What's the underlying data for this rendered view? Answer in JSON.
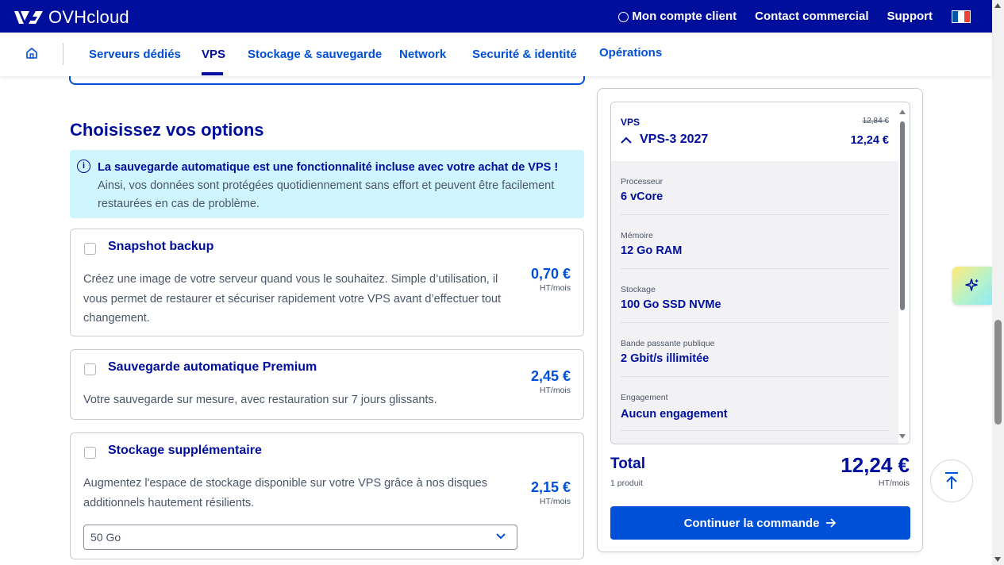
{
  "topbar": {
    "logo_text": "OVHcloud",
    "account_label": "Mon compte client",
    "contact_label": "Contact commercial",
    "support_label": "Support",
    "flag_colors": [
      "#0055a4",
      "#ffffff",
      "#ef4135"
    ]
  },
  "nav": {
    "items": [
      {
        "label": "Serveurs dédiés"
      },
      {
        "label": "VPS"
      },
      {
        "label": "Stockage & sauvegarde"
      },
      {
        "label": "Network"
      },
      {
        "label": "Securité & identité"
      },
      {
        "label": "Opérations"
      }
    ],
    "active": "VPS"
  },
  "main": {
    "section_title": "Choisissez vos options",
    "info": {
      "title": "La sauvegarde automatique est une fonctionnalité incluse avec votre achat de VPS !",
      "body": "Ainsi, vos données sont protégées quotidiennement sans effort et peuvent être facilement restaurées en cas de problème."
    },
    "options": [
      {
        "title": "Snapshot backup",
        "description": "Créez une image de votre serveur quand vous le souhaitez. Simple d’utilisation, il vous permet de restaurer et sécuriser rapidement votre VPS avant d’effectuer tout changement.",
        "price": "0,70 €",
        "unit": "HT/mois",
        "checked": false
      },
      {
        "title": "Sauvegarde automatique Premium",
        "description": "Votre sauvegarde sur mesure, avec restauration sur 7 jours glissants.",
        "price": "2,45 €",
        "unit": "HT/mois",
        "checked": false
      },
      {
        "title": "Stockage supplémentaire",
        "description": "Augmentez l'espace de stockage disponible sur votre VPS grâce à nos disques additionnels hautement résilients.",
        "price": "2,15 €",
        "unit": "HT/mois",
        "checked": false,
        "select_value": "50 Go"
      }
    ]
  },
  "summary": {
    "category": "VPS",
    "old_price": "12,84 €",
    "product_name": "VPS-3 2027",
    "price": "12,24 €",
    "specs": [
      {
        "label": "Processeur",
        "value": "6 vCore"
      },
      {
        "label": "Mémoire",
        "value": "12 Go RAM"
      },
      {
        "label": "Stockage",
        "value": "100 Go SSD NVMe"
      },
      {
        "label": "Bande passante publique",
        "value": "2 Gbit/s illimitée"
      },
      {
        "label": "Engagement",
        "value": "Aucun engagement"
      }
    ],
    "total_label": "Total",
    "total_count": "1 produit",
    "total_value": "12,24 €",
    "total_unit": "HT/mois",
    "cta_label": "Continuer la commande"
  },
  "colors": {
    "brand_dark": "#000e9c",
    "brand_blue": "#0050d7",
    "info_bg": "#cff5fd"
  }
}
